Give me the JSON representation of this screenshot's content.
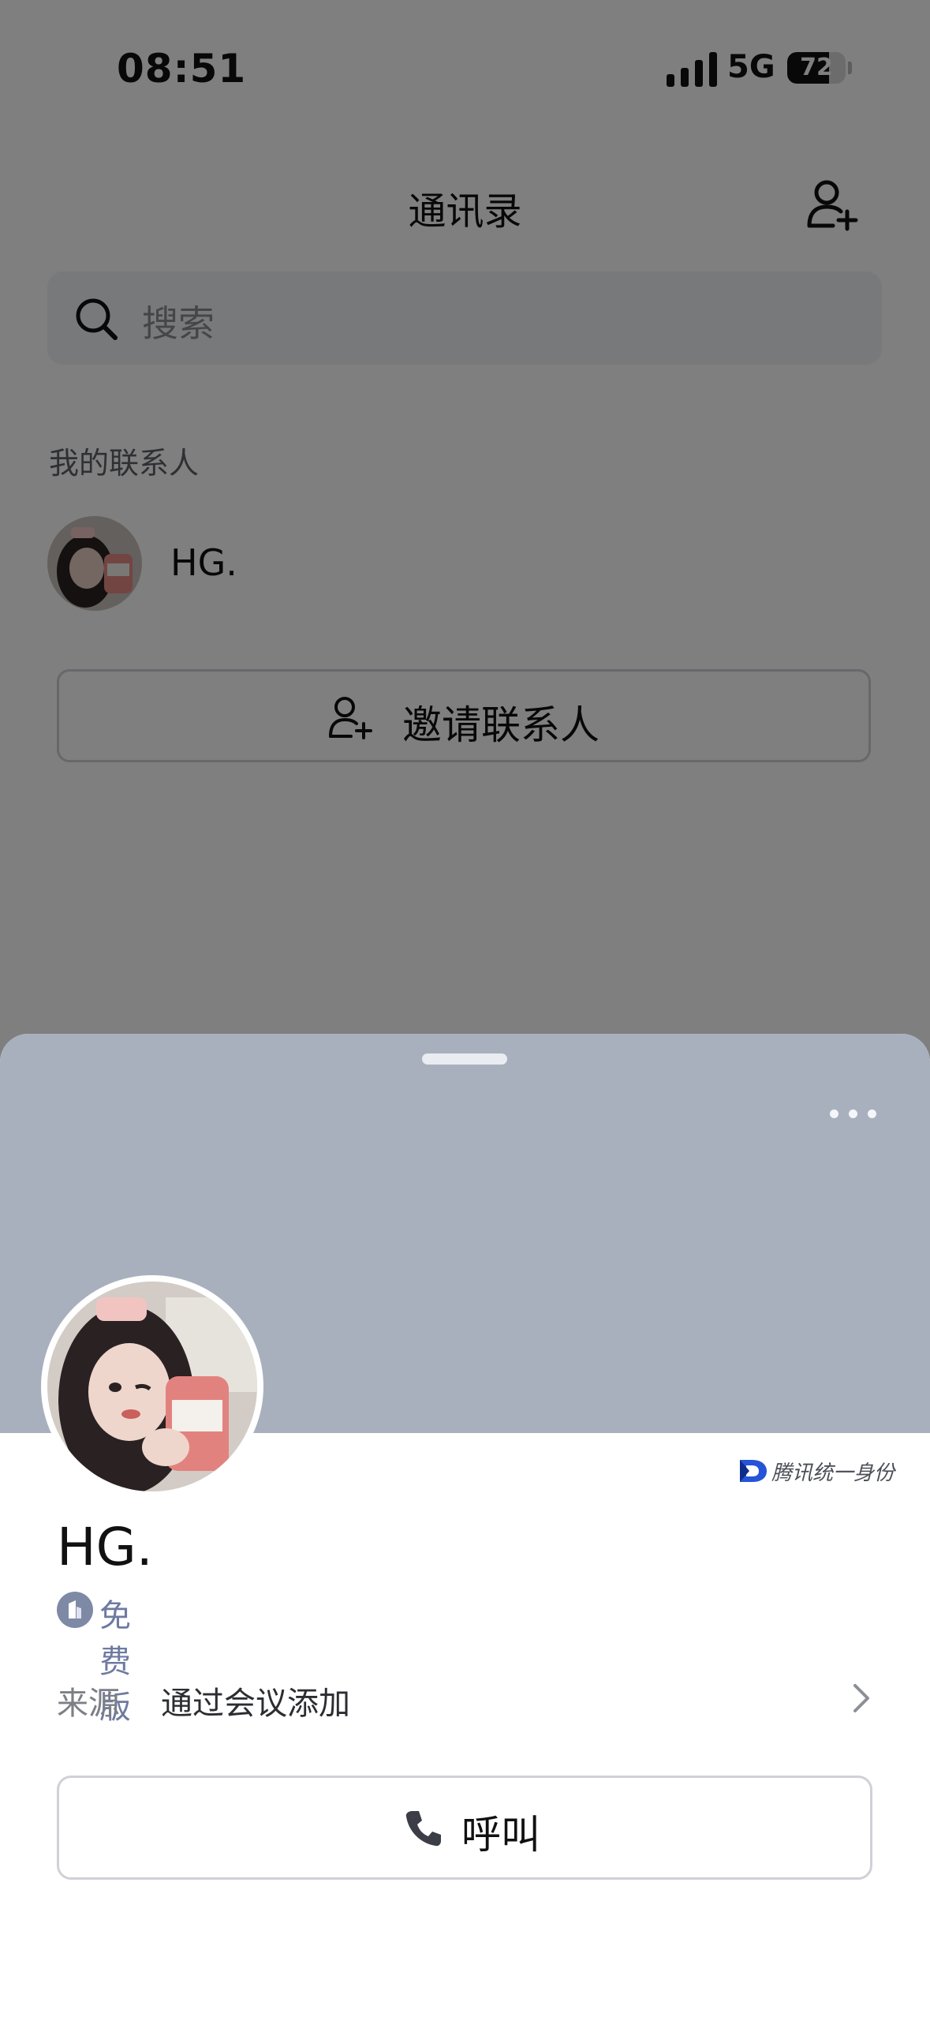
{
  "status_bar": {
    "time": "08:51",
    "network": "5G",
    "battery": "72",
    "battery_level": 0.72
  },
  "nav": {
    "title": "通讯录",
    "add_icon": "add-person-icon"
  },
  "search": {
    "placeholder": "搜索",
    "icon": "search-icon"
  },
  "contacts": {
    "section_title": "我的联系人",
    "items": [
      {
        "name": "HG."
      }
    ]
  },
  "invite": {
    "label": "邀请联系人",
    "icon": "add-person-icon"
  },
  "sheet": {
    "identity_badge": "腾讯统一身份",
    "name": "HG.",
    "plan": "免费版",
    "source_key": "来源",
    "source_value": "通过会议添加",
    "call_label": "呼叫",
    "colors": {
      "banner": "#a9b0bd",
      "plan": "#6e7aa0"
    }
  }
}
